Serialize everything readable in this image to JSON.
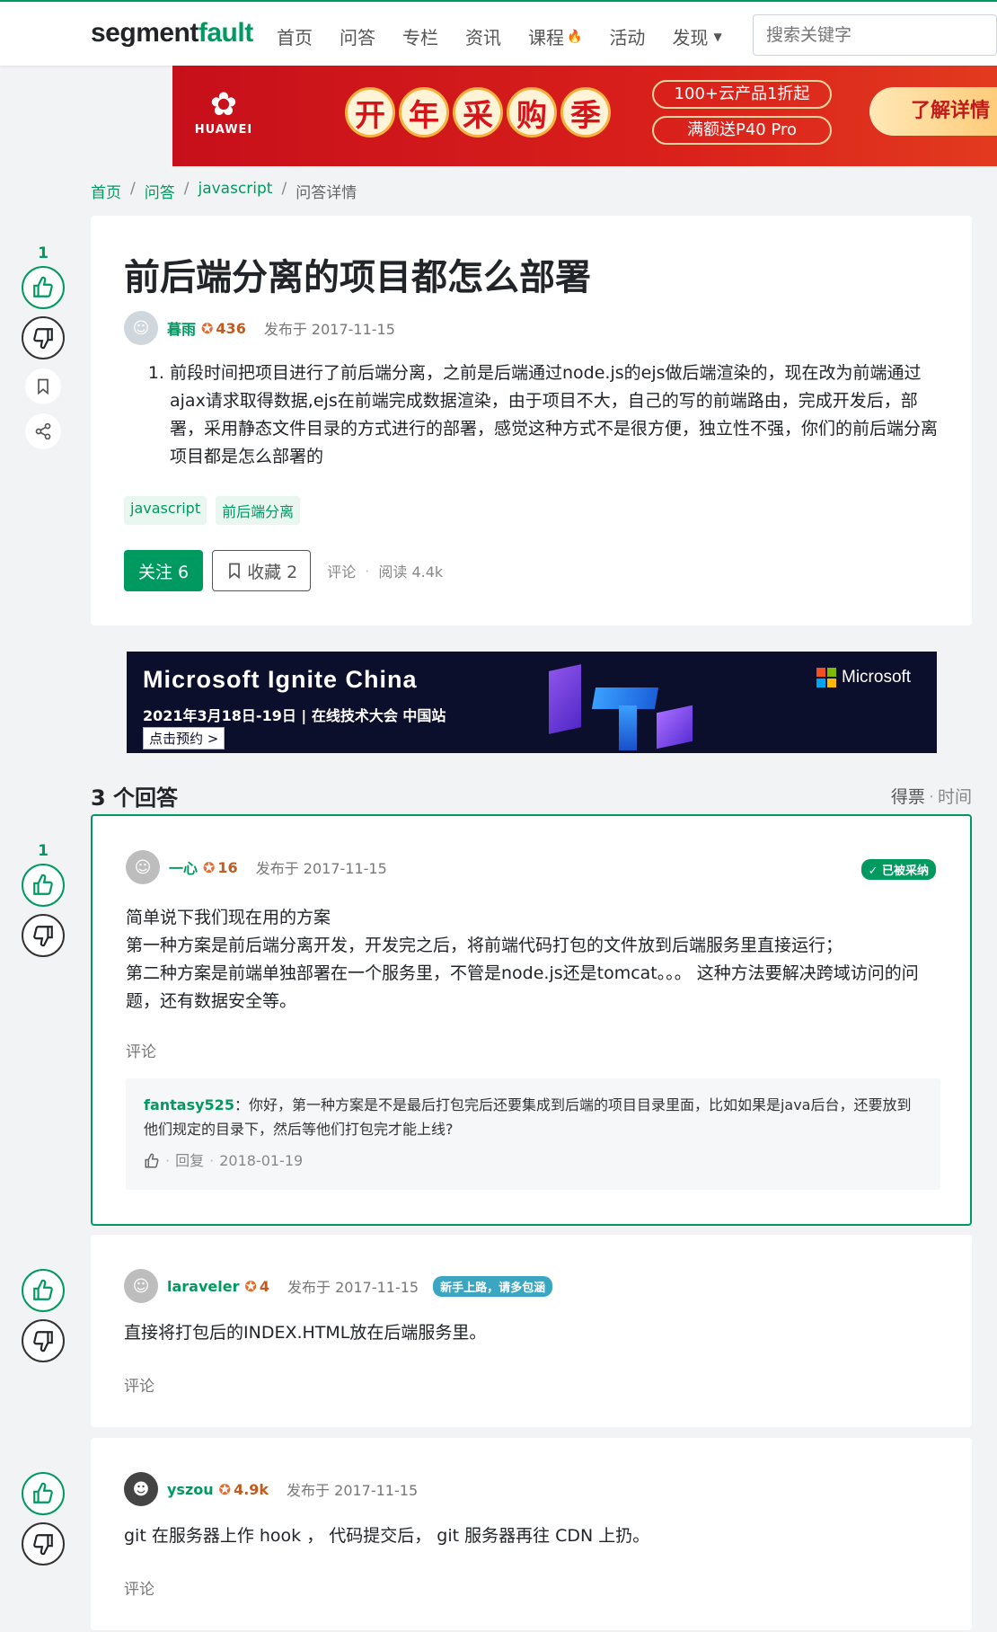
{
  "header": {
    "logo_seg": "segment",
    "logo_fault": "fault",
    "nav": [
      "首页",
      "问答",
      "专栏",
      "资讯",
      "课程",
      "活动",
      "发现"
    ],
    "search_placeholder": "搜索关键字"
  },
  "banner_huawei": {
    "brand": "HUAWEI",
    "chars": [
      "开",
      "年",
      "采",
      "购",
      "季"
    ],
    "promo1": "100+云产品1折起",
    "promo2": "满额送P40 Pro",
    "cta": "了解详情"
  },
  "breadcrumb": {
    "home": "首页",
    "qa": "问答",
    "tag": "javascript",
    "current": "问答详情",
    "sep": "/"
  },
  "question": {
    "votes": "1",
    "title": "前后端分离的项目都怎么部署",
    "author": "暮雨",
    "reputation": "436",
    "published": "发布于 2017-11-15",
    "body": "前段时间把项目进行了前后端分离，之前是后端通过node.js的ejs做后端渲染的，现在改为前端通过ajax请求取得数据,ejs在前端完成数据渲染，由于项目不大，自己的写的前端路由，完成开发后，部署，采用静态文件目录的方式进行的部署，感觉这种方式不是很方便，独立性不强，你们的前后端分离项目都是怎么部署的",
    "tags": [
      "javascript",
      "前后端分离"
    ],
    "follow_label": "关注 6",
    "fav_label": "收藏 2",
    "comment_label": "评论",
    "read_label": "阅读 4.4k"
  },
  "banner_ms": {
    "title": "Microsoft Ignite China",
    "subtitle": "2021年3月18日-19日 | 在线技术大会 中国站",
    "cta": "点击预约 >",
    "brand": "Microsoft"
  },
  "answers_header": {
    "count": "3 个回答",
    "sort_votes": "得票",
    "sort_time": "时间"
  },
  "answers": [
    {
      "votes": "1",
      "author": "一心",
      "reputation": "16",
      "published": "发布于 2017-11-15",
      "badge": "已被采纳",
      "body_lines": [
        "简单说下我们现在用的方案",
        "第一种方案是前后端分离开发，开发完之后，将前端代码打包的文件放到后端服务里直接运行；",
        "第二种方案是前端单独部署在一个服务里，不管是node.js还是tomcat。。。 这种方法要解决跨域访问的问题，还有数据安全等。"
      ],
      "comment_label": "评论",
      "reply": {
        "name": "fantasy525",
        "text": "：你好，第一种方案是不是最后打包完后还要集成到后端的项目目录里面，比如如果是java后台，还要放到他们规定的目录下，然后等他们打包完才能上线?",
        "reply_label": "回复",
        "date": "2018-01-19"
      }
    },
    {
      "votes": "",
      "author": "laraveler",
      "reputation": "4",
      "published": "发布于 2017-11-15",
      "badge": "新手上路，请多包涵",
      "body": "直接将打包后的INDEX.HTML放在后端服务里。",
      "comment_label": "评论"
    },
    {
      "votes": "",
      "author": "yszou",
      "reputation": "4.9k",
      "published": "发布于 2017-11-15",
      "body": "git 在服务器上作 hook ， 代码提交后， git 服务器再往 CDN 上扔。",
      "comment_label": "评论"
    }
  ]
}
